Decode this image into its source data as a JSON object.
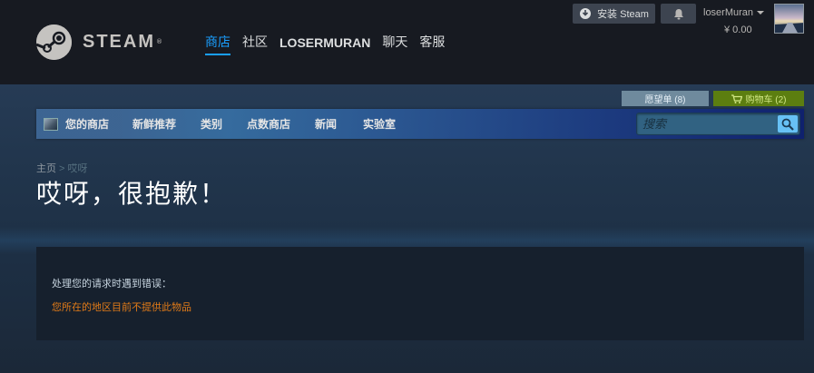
{
  "header": {
    "logo_text": "STEAM",
    "logo_mark": "®",
    "nav": [
      {
        "label": "商店",
        "active": true
      },
      {
        "label": "社区",
        "active": false
      },
      {
        "label": "LOSERMURAN",
        "active": false
      },
      {
        "label": "聊天",
        "active": false
      },
      {
        "label": "客服",
        "active": false
      }
    ],
    "install_label": "安装 Steam",
    "account_name": "loserMuran",
    "wallet_balance": "¥ 0.00"
  },
  "store": {
    "wishlist_label": "愿望单 (8)",
    "cart_label": "购物车 (2)",
    "nav": [
      {
        "label": "您的商店"
      },
      {
        "label": "新鲜推荐"
      },
      {
        "label": "类别"
      },
      {
        "label": "点数商店"
      },
      {
        "label": "新闻"
      },
      {
        "label": "实验室"
      }
    ],
    "search_placeholder": "搜索"
  },
  "page": {
    "breadcrumb": {
      "home": "主页",
      "separator": ">",
      "current": "哎呀"
    },
    "title": "哎呀，很抱歉！",
    "error_intro": "处理您的请求时遇到错误：",
    "error_message": "您所在的地区目前不提供此物品"
  },
  "colors": {
    "header_bg": "#171a21",
    "accent_blue": "#1a9fff",
    "cart_green": "#5c7e10",
    "error_orange": "#e07a18"
  }
}
